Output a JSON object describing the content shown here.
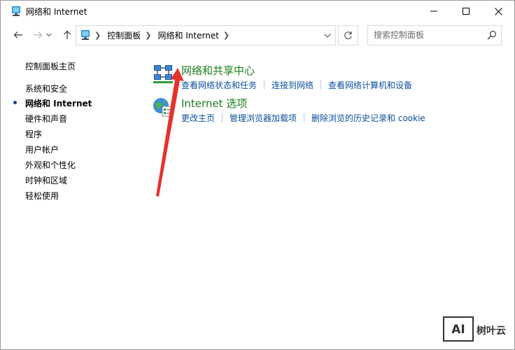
{
  "window": {
    "title": "网络和 Internet"
  },
  "titlebar": {
    "minimize_icon": "minimize-icon",
    "maximize_icon": "maximize-icon",
    "close_icon": "close-icon"
  },
  "navbar": {
    "back_icon": "arrow-left-icon",
    "forward_icon": "arrow-right-icon",
    "recent_icon": "chevron-down-icon",
    "up_icon": "arrow-up-icon",
    "breadcrumbs": [
      "控制面板",
      "网络和 Internet"
    ],
    "refresh_icon": "refresh-icon",
    "search": {
      "placeholder": "搜索控制面板"
    }
  },
  "sidebar": {
    "home": "控制面板主页",
    "items": [
      {
        "label": "系统和安全",
        "active": false
      },
      {
        "label": "网络和 Internet",
        "active": true
      },
      {
        "label": "硬件和声音",
        "active": false
      },
      {
        "label": "程序",
        "active": false
      },
      {
        "label": "用户帐户",
        "active": false
      },
      {
        "label": "外观和个性化",
        "active": false
      },
      {
        "label": "时钟和区域",
        "active": false
      },
      {
        "label": "轻松使用",
        "active": false
      }
    ]
  },
  "main": {
    "categories": [
      {
        "title": "网络和共享中心",
        "icon": "network-sharing-center-icon",
        "links": [
          "查看网络状态和任务",
          "连接到网络",
          "查看网络计算机和设备"
        ]
      },
      {
        "title": "Internet 选项",
        "icon": "internet-options-icon",
        "links": [
          "更改主页",
          "管理浏览器加载项",
          "删除浏览的历史记录和 cookie"
        ]
      }
    ]
  },
  "annotation": {
    "color": "#e5322d"
  },
  "watermark": {
    "logo": "AI",
    "text": "树叶云"
  },
  "colors": {
    "link": "#0b4f9e",
    "category_title": "#1e7d1e",
    "active_bullet": "#1f3a93"
  }
}
